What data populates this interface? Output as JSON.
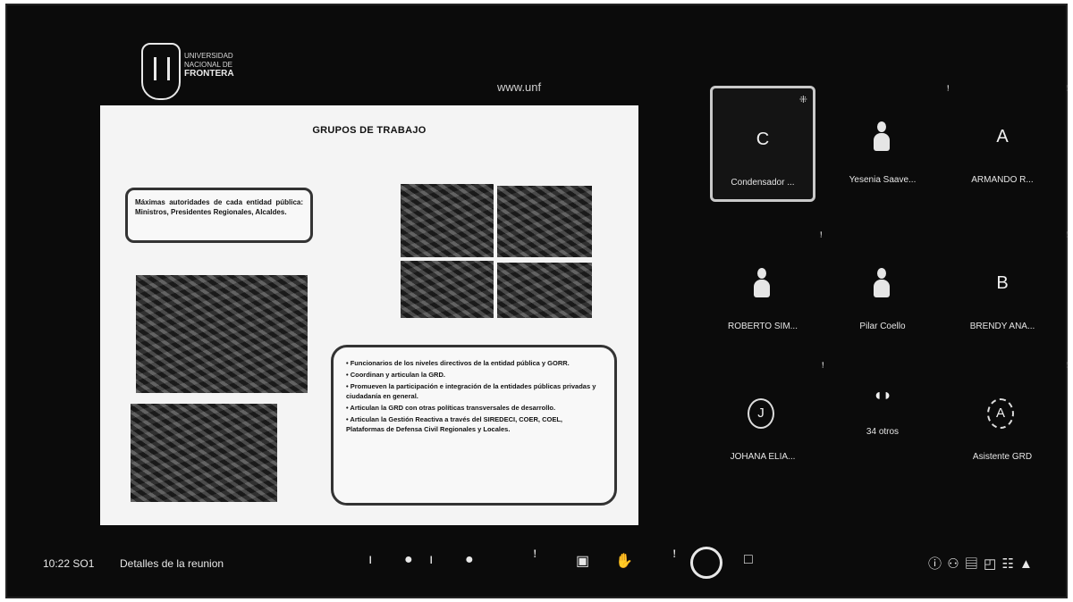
{
  "slide": {
    "university_lines": [
      "UNIVERSIDAD",
      "NACIONAL DE",
      "FRONTERA"
    ],
    "url": "www.unf",
    "title": "GRUPOS DE TRABAJO",
    "box1_text": "Máximas autoridades de cada entidad pública: Ministros, Presidentes Regionales, Alcaldes.",
    "box2_items": [
      "• Funcionarios de los niveles directivos de la entidad pública y GORR.",
      "• Coordinan y articulan la GRD.",
      "• Promueven la participación e integración de la entidades públicas privadas y ciudadanía en general.",
      "• Articulan la GRD con otras políticas transversales de desarrollo.",
      "• Articulan la Gestión Reactiva a través del SIREDECI, COER, COEL, Plataformas de Defensa Civil Regionales y Locales."
    ]
  },
  "participants": [
    {
      "name": "Condensador ...",
      "avatar": "C",
      "type": "letter",
      "active": true
    },
    {
      "name": "Yesenia Saave...",
      "avatar": "",
      "type": "photo"
    },
    {
      "name": "ARMANDO R...",
      "avatar": "A",
      "type": "letter"
    },
    {
      "name": "ROBERTO SIM...",
      "avatar": "",
      "type": "photo"
    },
    {
      "name": "Pilar Coello",
      "avatar": "",
      "type": "photo"
    },
    {
      "name": "BRENDY ANA...",
      "avatar": "B",
      "type": "letter"
    },
    {
      "name": "JOHANA ELIA...",
      "avatar": "J",
      "type": "circle"
    },
    {
      "name": "34 otros",
      "avatar": "",
      "type": "group"
    },
    {
      "name": "Asistente GRD",
      "avatar": "A",
      "type": "circle"
    }
  ],
  "bottom_bar": {
    "time": "10:22 SO1",
    "details": "Detalles de la reunion"
  },
  "icons": {
    "mic": "microphone-icon",
    "camera": "camera-icon",
    "hand": "hand-icon",
    "share": "share-icon",
    "leave": "leave-icon"
  }
}
